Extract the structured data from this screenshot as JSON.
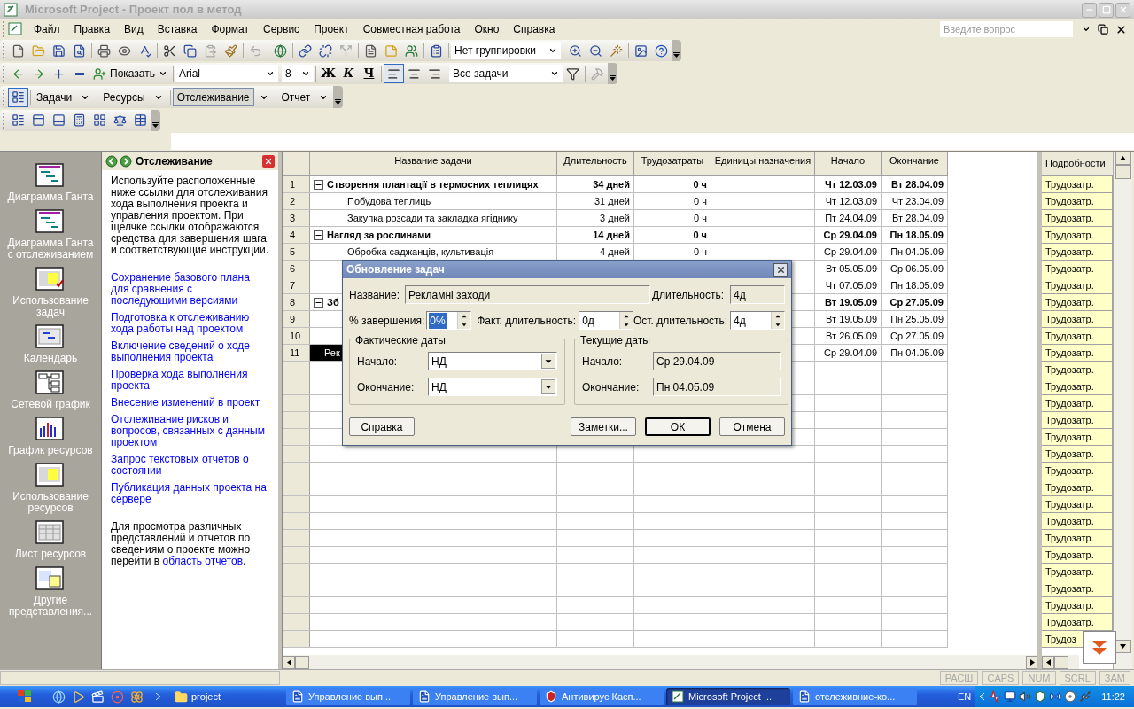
{
  "window": {
    "title": "Microsoft Project - Проект пол в метод",
    "active": false
  },
  "menu": [
    "Файл",
    "Правка",
    "Вид",
    "Вставка",
    "Формат",
    "Сервис",
    "Проект",
    "Совместная работа",
    "Окно",
    "Справка"
  ],
  "help_box": {
    "placeholder": "Введите вопрос"
  },
  "standard_toolbar": {
    "grouping": "Нет группировки"
  },
  "formatting_toolbar": {
    "show": "Показать",
    "font": "Arial",
    "size": "8",
    "bold": "Ж",
    "italic": "К",
    "underline": "Ч",
    "alignment": [
      {
        "selected": true
      },
      {
        "selected": false
      },
      {
        "selected": false
      }
    ],
    "filter": "Все задачи"
  },
  "guide_toolbar": [
    {
      "label": "Задачи",
      "selected": false
    },
    {
      "label": "Ресурсы",
      "selected": false
    },
    {
      "label": "Отслеживание",
      "selected": true
    },
    {
      "label": "Отчет",
      "selected": false
    }
  ],
  "view_bar": [
    {
      "label": "Диаграмма Ганта"
    },
    {
      "label": "Диаграмма Ганта с отслеживанием"
    },
    {
      "label": "Использование задач"
    },
    {
      "label": "Календарь"
    },
    {
      "label": "Сетевой график"
    },
    {
      "label": "График ресурсов"
    },
    {
      "label": "Использование ресурсов"
    },
    {
      "label": "Лист ресурсов"
    },
    {
      "label": "Другие представления..."
    }
  ],
  "task_pane": {
    "title": "Отслеживание",
    "intro": "Используйте расположенные ниже ссылки для отслеживания хода выполнения проекта и управления проектом. При щелчке ссылки отображаются средства для завершения шага и соответствующие инструкции.",
    "links": [
      "Сохранение базового плана для сравнения с последующими версиями",
      "Подготовка к отслеживанию хода работы над проектом",
      "Включение сведений о ходе выполнения проекта",
      "Проверка хода выполнения проекта",
      "Внесение изменений в проект",
      "Отслеживание рисков и вопросов, связанных с данным проектом",
      "Запрос текстовых отчетов о состоянии",
      "Публикация данных проекта на сервере"
    ],
    "footer": {
      "text": "Для просмотра различных представлений и отчетов по сведениям о проекте можно перейти в",
      "link": "область отчетов",
      "end": "."
    }
  },
  "table": {
    "columns": [
      "Название задачи",
      "Длительность",
      "Трудозатраты",
      "Единицы назначения",
      "Начало",
      "Окончание"
    ],
    "rows": [
      {
        "id": "1",
        "kind": "summary",
        "expanded": true,
        "selected": false,
        "name": "Створення плантації  в термосних теплицях",
        "duration": "34 дней",
        "work": "0 ч",
        "start": "Чт 12.03.09",
        "finish": "Вт 28.04.09"
      },
      {
        "id": "2",
        "kind": "task",
        "selected": false,
        "name": "Побудова теплиць",
        "duration": "31 дней",
        "work": "0 ч",
        "start": "Чт 12.03.09",
        "finish": "Чт 23.04.09"
      },
      {
        "id": "3",
        "kind": "task",
        "selected": false,
        "name": "Закупка розсади та закладка ягіднику",
        "duration": "3 дней",
        "work": "0 ч",
        "start": "Пт 24.04.09",
        "finish": "Вт 28.04.09"
      },
      {
        "id": "4",
        "kind": "summary",
        "expanded": true,
        "selected": false,
        "name": "Нагляд за рослинами",
        "duration": "14 дней",
        "work": "0 ч",
        "start": "Ср 29.04.09",
        "finish": "Пн 18.05.09"
      },
      {
        "id": "5",
        "kind": "task",
        "selected": false,
        "name": "Обробка саджанців, культивація",
        "duration": "4 дней",
        "work": "0 ч",
        "start": "Ср 29.04.09",
        "finish": "Пн 04.05.09"
      },
      {
        "id": "6",
        "kind": "task",
        "selected": false,
        "start": "Вт 05.05.09",
        "finish": "Ср 06.05.09"
      },
      {
        "id": "7",
        "kind": "task",
        "selected": false,
        "start": "Чт 07.05.09",
        "finish": "Пн 18.05.09"
      },
      {
        "id": "8",
        "kind": "summary",
        "expanded": true,
        "selected": false,
        "name": "Зб",
        "start": "Вт 19.05.09",
        "finish": "Ср 27.05.09"
      },
      {
        "id": "9",
        "kind": "task",
        "selected": false,
        "start": "Вт 19.05.09",
        "finish": "Пн 25.05.09"
      },
      {
        "id": "10",
        "kind": "task",
        "selected": false,
        "start": "Вт 26.05.09",
        "finish": "Ср 27.05.09"
      },
      {
        "id": "11",
        "kind": "task",
        "selected": true,
        "name": "Рек",
        "start": "Ср 29.04.09",
        "finish": "Пн 04.05.09"
      }
    ]
  },
  "details": {
    "header": "Подробности",
    "rows": [
      "Трудозатр.",
      "Трудозатр.",
      "Трудозатр.",
      "Трудозатр.",
      "Трудозатр.",
      "Трудозатр.",
      "Трудозатр.",
      "Трудозатр.",
      "Трудозатр.",
      "Трудозатр.",
      "Трудозатр.",
      "Трудозатр.",
      "Трудозатр.",
      "Трудозатр.",
      "Трудозатр.",
      "Трудозатр.",
      "Трудозатр.",
      "Трудозатр.",
      "Трудозатр.",
      "Трудозатр.",
      "Трудозатр.",
      "Трудозатр.",
      "Трудозатр.",
      "Трудозатр.",
      "Трудозатр.",
      "Трудозатр.",
      "Трудозатр.",
      "Трудоз"
    ]
  },
  "dialog": {
    "title": "Обновление задач",
    "name_label": "Название:",
    "name": "Рекламні заходи",
    "duration_label": "Длительность:",
    "duration": "4д",
    "percent_label": "% завершения:",
    "percent": {
      "value": "0%",
      "selected": true
    },
    "actual_duration_label": "Факт. длительность:",
    "actual_duration": "0д",
    "remaining_label": "Ост. длительность:",
    "remaining": "4д",
    "actual_group": {
      "title": "Фактические даты",
      "start_label": "Начало:",
      "start": "НД",
      "finish_label": "Окончание:",
      "finish": "НД"
    },
    "current_group": {
      "title": "Текущие даты",
      "start_label": "Начало:",
      "start": "Ср 29.04.09",
      "finish_label": "Окончание:",
      "finish": "Пн 04.05.09"
    },
    "buttons": [
      {
        "label": "Справка",
        "default": false
      },
      {
        "label": "Заметки...",
        "default": false
      },
      {
        "label": "ОК",
        "default": true
      },
      {
        "label": "Отмена",
        "default": false
      }
    ]
  },
  "status_bar": [
    {
      "label": "РАСШ",
      "on": false
    },
    {
      "label": "CAPS",
      "on": false
    },
    {
      "label": "NUM",
      "on": false
    },
    {
      "label": "SCRL",
      "on": false
    },
    {
      "label": "ЗАМ",
      "on": false
    }
  ],
  "taskbar": {
    "folder": "project",
    "tasks": [
      {
        "label": "Управление вып...",
        "kind": "word",
        "selected": false
      },
      {
        "label": "Управление вып...",
        "kind": "word",
        "selected": false
      },
      {
        "label": "Антивирус Касп...",
        "kind": "antivirus",
        "selected": false
      },
      {
        "label": "Microsoft Project ...",
        "kind": "project",
        "selected": true
      },
      {
        "label": "отслеживние-ко...",
        "kind": "word",
        "selected": false
      }
    ],
    "language": "EN",
    "clock": "11:22"
  }
}
